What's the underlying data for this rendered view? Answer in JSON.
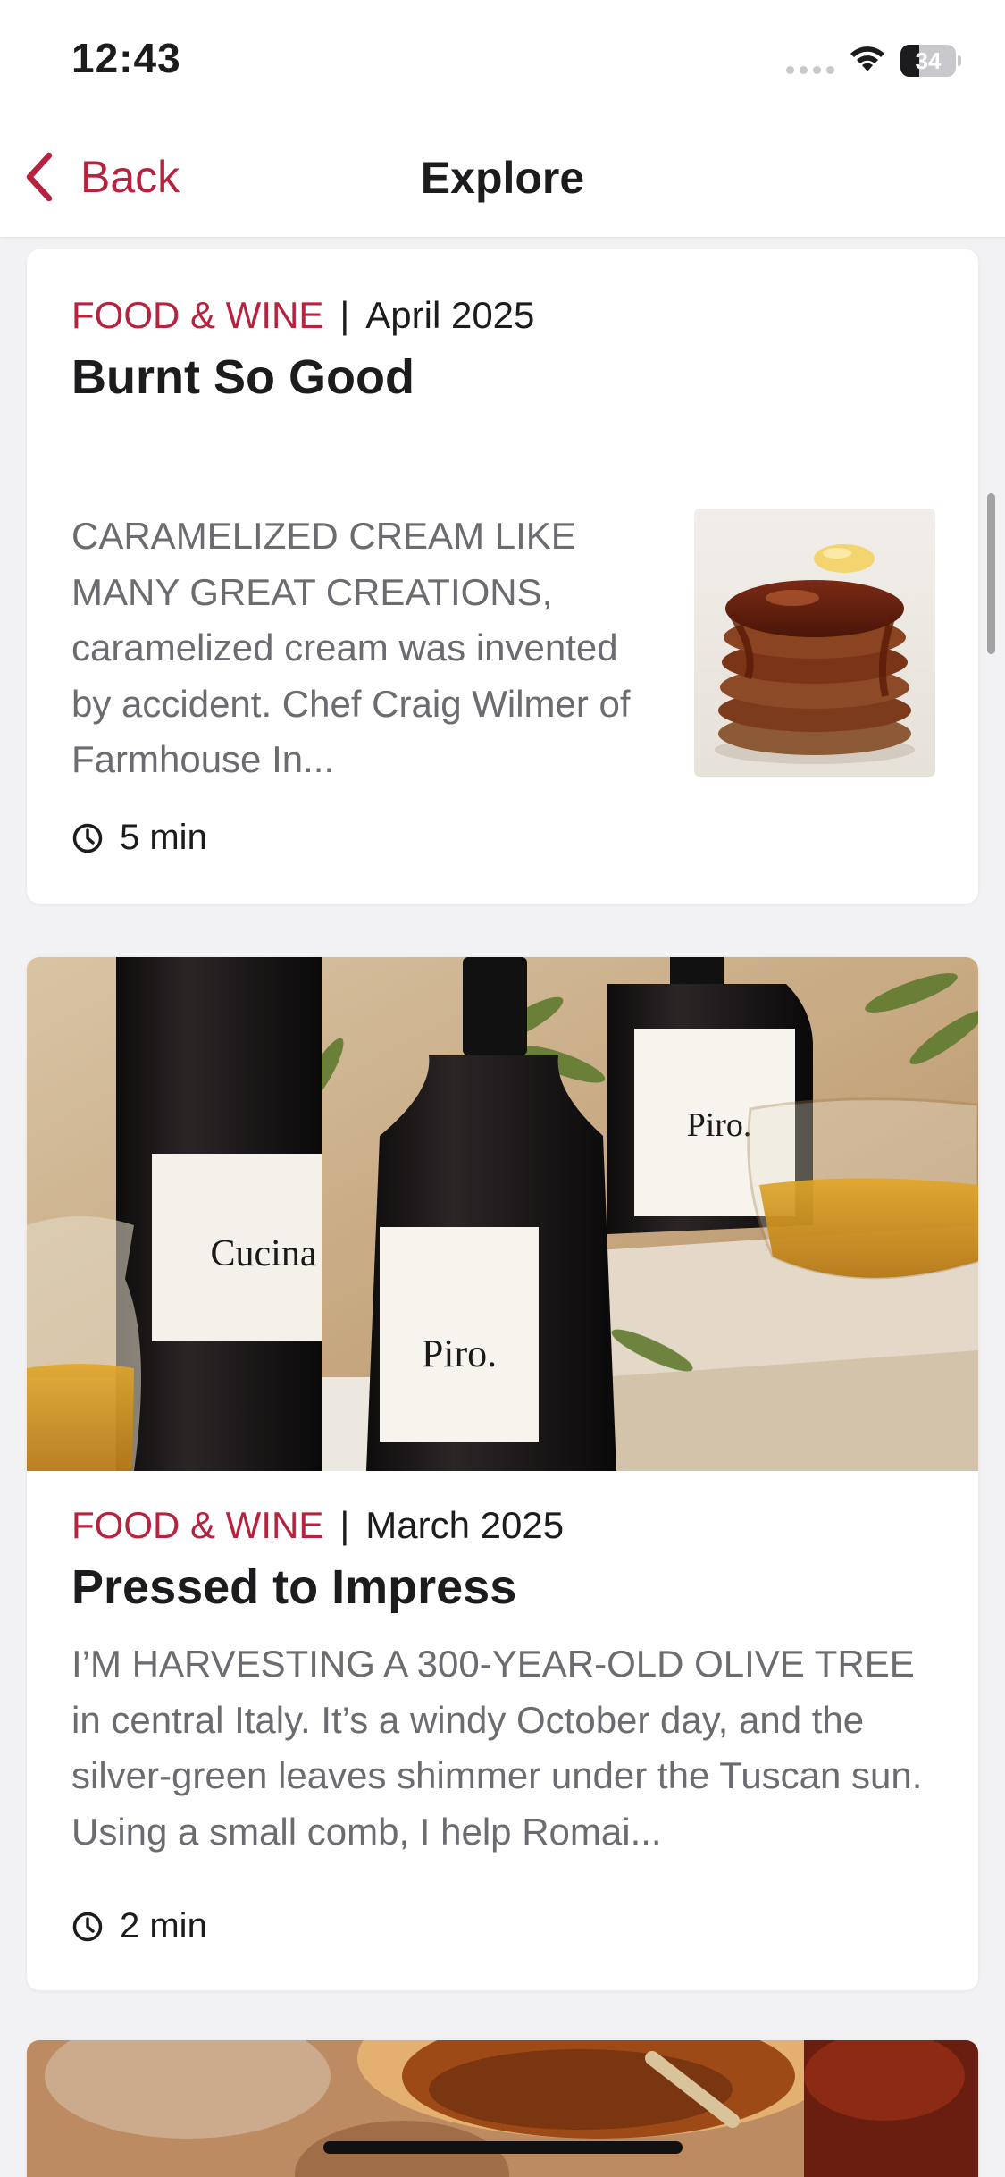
{
  "status_bar": {
    "time": "12:43",
    "battery_level": "34",
    "battery_fraction": 0.34,
    "icons": [
      "signal-dots-icon",
      "wifi-icon",
      "battery-icon"
    ]
  },
  "nav": {
    "back_label": "Back",
    "back_icon": "chevron-left-icon",
    "title": "Explore"
  },
  "colors": {
    "accent": "#b5233f",
    "text": "#1c1c1e",
    "muted": "#6b6b70",
    "background": "#f2f2f4",
    "card": "#ffffff"
  },
  "articles": [
    {
      "source": "FOOD & WINE",
      "separator": "|",
      "date": "April 2025",
      "title": "Burnt So Good",
      "excerpt": "CARAMELIZED CREAM LIKE MANY GREAT CREATIONS, caramelized cream was invented by accident. Chef Craig Wilmer of Farmhouse In...",
      "read_time": "5 min",
      "image": "pancake-stack-thumbnail"
    },
    {
      "source": "FOOD & WINE",
      "separator": "|",
      "date": "March 2025",
      "title": "Pressed to Impress",
      "excerpt": "I’M HARVESTING A 300-YEAR-OLD OLIVE TREE in central Italy. It’s a windy October day, and the silver-green leaves shimmer under the Tuscan sun. Using a small comb, I help Romai...",
      "read_time": "2 min",
      "image": "olive-oil-bottles-photo",
      "image_labels": [
        "Piro.",
        "Piro.",
        "Cucina"
      ]
    },
    {
      "image": "sauce-bowls-photo"
    }
  ]
}
